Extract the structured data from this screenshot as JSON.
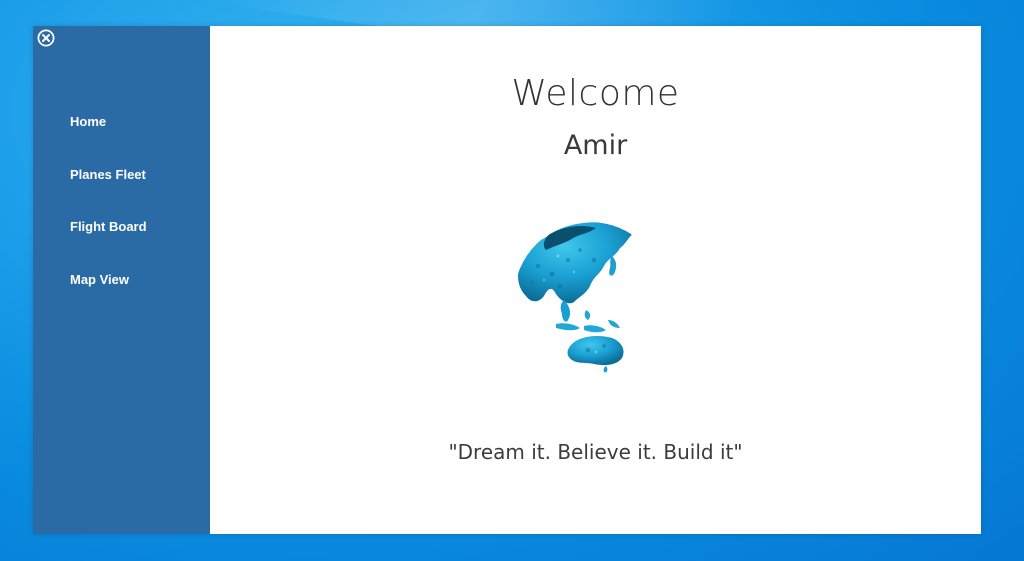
{
  "sidebar": {
    "close_icon": "close-circle-icon",
    "items": [
      {
        "label": "Home"
      },
      {
        "label": "Planes Fleet"
      },
      {
        "label": "Flight Board"
      },
      {
        "label": "Map View"
      }
    ]
  },
  "main": {
    "title": "Welcome",
    "user_name": "Amir",
    "image": "globe-illustration",
    "quote": "\"Dream it. Believe it. Build it\""
  },
  "colors": {
    "sidebar_bg": "#2a6ba6",
    "main_bg": "#ffffff",
    "desktop_bg": "#1a98e6",
    "globe_accent": "#1aa3d6"
  }
}
